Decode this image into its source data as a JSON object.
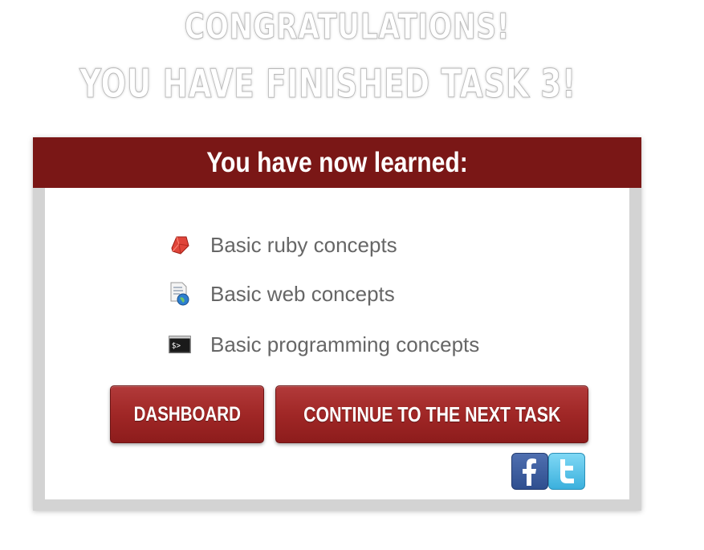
{
  "headline": {
    "line1": "CONGRATULATIONS!",
    "line2": "YOU HAVE FINISHED TASK 3!"
  },
  "panel": {
    "title": "You have now learned:",
    "items": [
      {
        "label": "Basic ruby concepts",
        "icon": "ruby-gem-icon"
      },
      {
        "label": "Basic web concepts",
        "icon": "web-document-icon"
      },
      {
        "label": "Basic programming concepts",
        "icon": "terminal-icon"
      }
    ]
  },
  "buttons": {
    "dashboard": "DASHBOARD",
    "next_task": "CONTINUE TO THE NEXT TASK"
  },
  "social": {
    "facebook": "facebook-icon",
    "twitter": "twitter-icon"
  },
  "colors": {
    "header_bg": "#7a1716",
    "button_red": "#a02726",
    "panel_border": "#d3d3d3",
    "item_text": "#666666"
  }
}
